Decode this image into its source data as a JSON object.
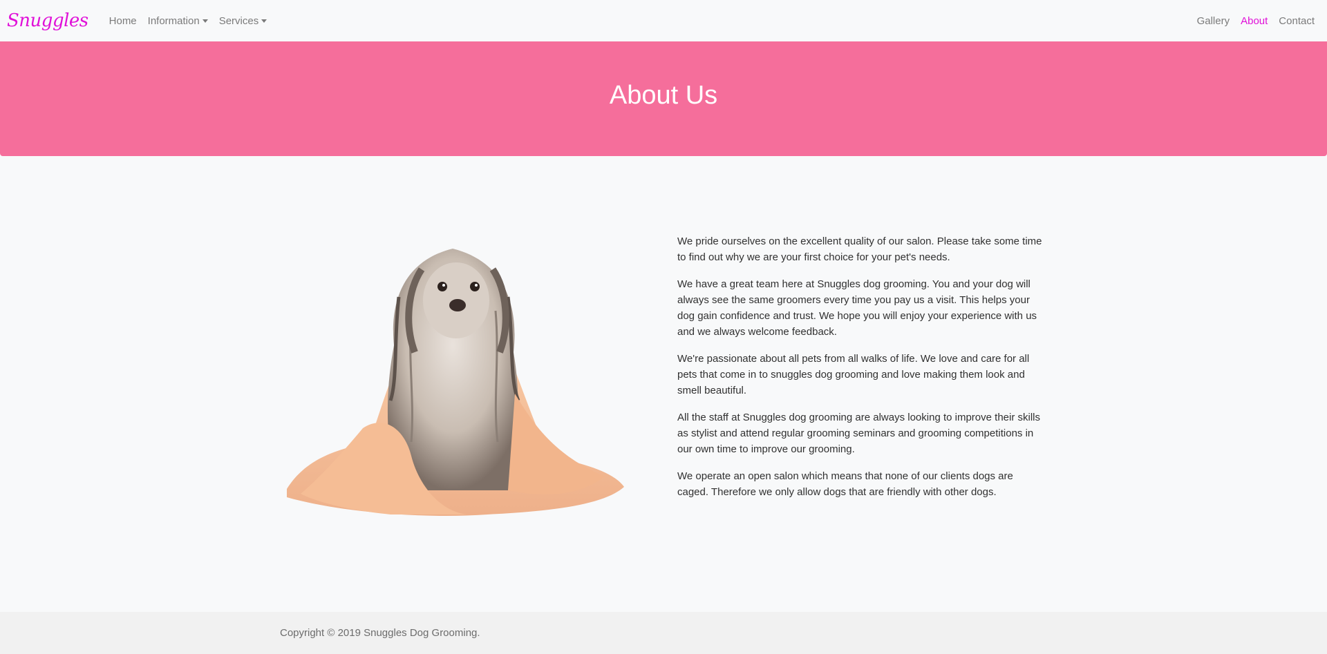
{
  "navbar": {
    "brand": "Snuggles",
    "left_links": [
      {
        "label": "Home"
      },
      {
        "label": "Information",
        "dropdown": true
      },
      {
        "label": "Services",
        "dropdown": true
      }
    ],
    "right_links": [
      {
        "label": "Gallery"
      },
      {
        "label": "About",
        "active": true
      },
      {
        "label": "Contact"
      }
    ]
  },
  "hero": {
    "title": "About Us"
  },
  "about": {
    "image_subject": "wet-dog-in-towel",
    "paragraphs": [
      "We pride ourselves on the excellent quality of our salon. Please take some time to find out why we are your first choice for your pet's needs.",
      "We have a great team here at Snuggles dog grooming. You and your dog will always see the same groomers every time you pay us a visit. This helps your dog gain confidence and trust. We hope you will enjoy your experience with us and we always welcome feedback.",
      "We're passionate about all pets from all walks of life. We love and care for all pets that come in to snuggles dog grooming and love making them look and smell beautiful.",
      "All the staff at Snuggles dog grooming are always looking to improve their skills as stylist and attend regular grooming seminars and grooming competitions in our own time to improve our grooming.",
      "We operate an open salon which means that none of our clients dogs are caged. Therefore we only allow dogs that are friendly with other dogs."
    ]
  },
  "footer": {
    "copyright": "Copyright © 2019 Snuggles Dog Grooming."
  },
  "colors": {
    "brand": "#e010d8",
    "hero_bg": "#f56e9b",
    "page_bg": "#f8f9fa",
    "footer_bg": "#f1f1f1"
  }
}
